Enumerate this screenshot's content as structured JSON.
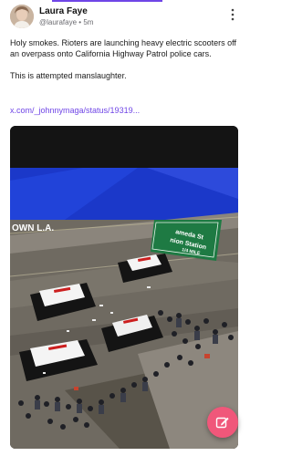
{
  "post": {
    "author_name": "Laura Faye",
    "author_handle": "@laurafaye",
    "separator": "•",
    "time_ago": "5m",
    "text_line1": "Holy smokes. Rioters are launching heavy electric scooters off an overpass onto California Highway Patrol police cars.",
    "text_line2": "This is attempted manslaughter.",
    "link_text": "x.com/_johnnymaga/status/19319..."
  },
  "media": {
    "overlay_text": "OWN L.A.",
    "sign_text_line1": "ameda St",
    "sign_text_line2": "nion Station",
    "sign_text_line3": "1/4 MILE"
  },
  "icons": {
    "more": "more-vertical-icon",
    "compose": "compose-icon"
  },
  "colors": {
    "accent": "#6f45e6",
    "fab": "#f0577a",
    "banner": "#1b38c9",
    "highway_sign": "#1e7a43"
  }
}
